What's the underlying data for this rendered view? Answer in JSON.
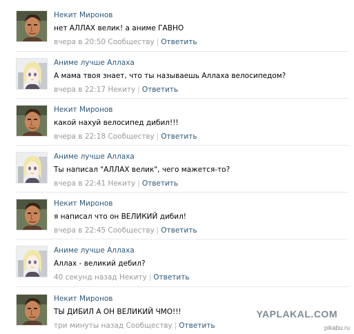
{
  "comments": [
    {
      "author": "Некит Миронов",
      "text": "нет АЛЛАХ велик! а аниме ГАВНО",
      "time": "вчера в 20:50",
      "to": "Сообществу",
      "reply": "Ответить",
      "avatar": "male-portrait"
    },
    {
      "author": "Аниме лучше Аллаха",
      "text": "А мама твоя знает, что ты называешь Аллаха велосипедом?",
      "time": "вчера в 22:17",
      "to": "Некиту",
      "reply": "Ответить",
      "avatar": "anime-girl"
    },
    {
      "author": "Некит Миронов",
      "text": "какой нахуй велосипед дибил!!!",
      "time": "вчера в 22:18",
      "to": "Сообществу",
      "reply": "Ответить",
      "avatar": "male-portrait"
    },
    {
      "author": "Аниме лучше Аллаха",
      "text": "Ты написал \"АЛЛАХ велик\", чего мажется-то?",
      "time": "вчера в 22:41",
      "to": "Некиту",
      "reply": "Ответить",
      "avatar": "anime-girl"
    },
    {
      "author": "Некит Миронов",
      "text": "я написал что он ВЕЛИКИЙ дибил!",
      "time": "вчера в 22:45",
      "to": "Сообществу",
      "reply": "Ответить",
      "avatar": "male-portrait"
    },
    {
      "author": "Аниме лучше Аллаха",
      "text": "Аллах - великий дебил?",
      "time": "40 секунд назад",
      "to": "Некиту",
      "reply": "Ответить",
      "avatar": "anime-girl"
    },
    {
      "author": "Некит Миронов",
      "text": "ТЫ ДИБИЛ А ОН ВЕЛИКИЙ ЧМО!!!",
      "time": "три минуты назад",
      "to": "Сообществу",
      "reply": "Ответить",
      "avatar": "male-portrait"
    }
  ],
  "separator": "|",
  "watermarks": {
    "yaplakal": "YAPLAKAL.COM",
    "pikabu": "pikabu.ru"
  },
  "colors": {
    "link": "#2b587a",
    "meta": "#999999",
    "divider": "#e7e8ec"
  }
}
